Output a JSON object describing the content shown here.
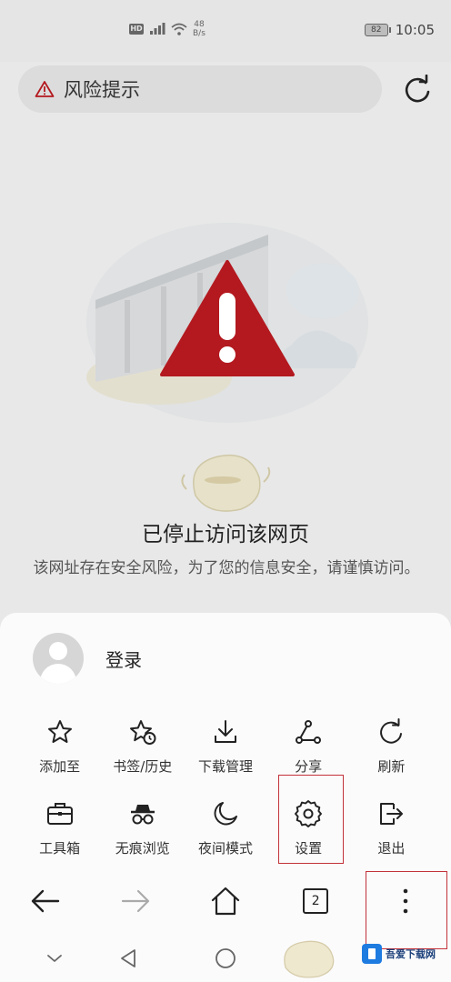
{
  "status_bar": {
    "net_speed_value": "48",
    "net_speed_unit": "B/s",
    "battery": "82",
    "time": "10:05"
  },
  "url_bar": {
    "text": "风险提示"
  },
  "page": {
    "title": "已停止访问该网页",
    "description": "该网址存在安全风险，为了您的信息安全，请谨慎访问。"
  },
  "menu": {
    "login_label": "登录",
    "row1": [
      {
        "label": "添加至",
        "icon": "star-icon"
      },
      {
        "label": "书签/历史",
        "icon": "bookmark-history-icon"
      },
      {
        "label": "下载管理",
        "icon": "download-icon"
      },
      {
        "label": "分享",
        "icon": "share-icon"
      },
      {
        "label": "刷新",
        "icon": "refresh-icon"
      }
    ],
    "row2": [
      {
        "label": "工具箱",
        "icon": "toolbox-icon"
      },
      {
        "label": "无痕浏览",
        "icon": "incognito-icon"
      },
      {
        "label": "夜间模式",
        "icon": "moon-icon"
      },
      {
        "label": "设置",
        "icon": "gear-icon"
      },
      {
        "label": "退出",
        "icon": "exit-icon"
      }
    ]
  },
  "bottom_nav": {
    "tab_count": "2"
  },
  "colors": {
    "warning_red": "#b3191f",
    "highlight_red": "#c2323a",
    "watermark_blue": "#1e7be0"
  },
  "watermark": {
    "text": "吾爱下载网"
  }
}
